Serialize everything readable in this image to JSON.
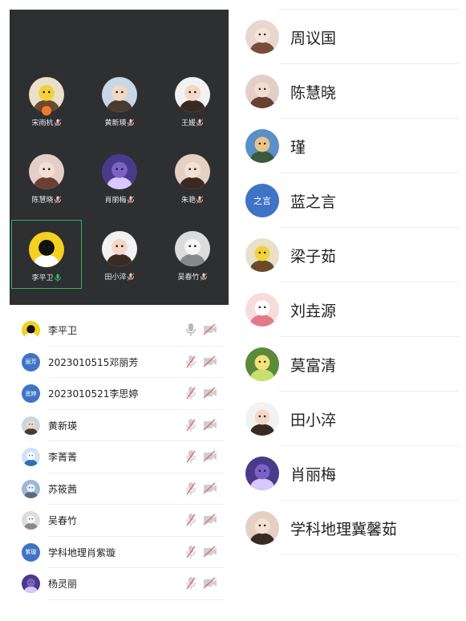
{
  "video_grid": {
    "tiles": [
      {
        "name": "宋雨杭",
        "host": true
      },
      {
        "name": "黄新瑛"
      },
      {
        "name": "王媛"
      },
      {
        "name": "陈慧晓"
      },
      {
        "name": "肖丽梅"
      },
      {
        "name": "朱艳"
      },
      {
        "name": "李平卫",
        "active": true
      },
      {
        "name": "田小淬"
      },
      {
        "name": "吴春竹"
      }
    ]
  },
  "members": [
    {
      "name": "李平卫",
      "avatar": "panda",
      "mic": "on"
    },
    {
      "name": "2023010515邓丽芳",
      "avatar_text": "丽芳",
      "mic": "muted"
    },
    {
      "name": "2023010521李思婷",
      "avatar_text": "思婷",
      "mic": "muted"
    },
    {
      "name": "黄新瑛",
      "avatar": "child",
      "mic": "muted"
    },
    {
      "name": "李菁菁",
      "avatar": "snowman",
      "mic": "muted"
    },
    {
      "name": "苏筱茜",
      "avatar": "sky",
      "mic": "muted"
    },
    {
      "name": "吴春竹",
      "avatar": "sketch",
      "mic": "muted"
    },
    {
      "name": "学科地理肖紫璇",
      "avatar_text": "紫璇",
      "mic": "muted"
    },
    {
      "name": "杨灵丽",
      "avatar": "monster",
      "mic": "muted"
    }
  ],
  "roster": [
    {
      "name": "周议国",
      "avatar": "baby"
    },
    {
      "name": "陈慧晓",
      "avatar": "baby2"
    },
    {
      "name": "瑾",
      "avatar": "landscape"
    },
    {
      "name": "蓝之言",
      "avatar_text": "之言"
    },
    {
      "name": "梁子茹",
      "avatar": "girl"
    },
    {
      "name": "刘垚源",
      "avatar": "pinkcat"
    },
    {
      "name": "莫富清",
      "avatar": "teletubby"
    },
    {
      "name": "田小淬",
      "avatar": "cartoon"
    },
    {
      "name": "肖丽梅",
      "avatar": "monster"
    },
    {
      "name": "学科地理冀馨茹",
      "avatar": "kid"
    }
  ],
  "colors": {
    "grid_bg": "#2d2f31",
    "active_border": "#33b36a",
    "mic_on": "#2ec36b",
    "muted": "#e06a6a",
    "avatar_text_bg": "#3f73c6"
  }
}
